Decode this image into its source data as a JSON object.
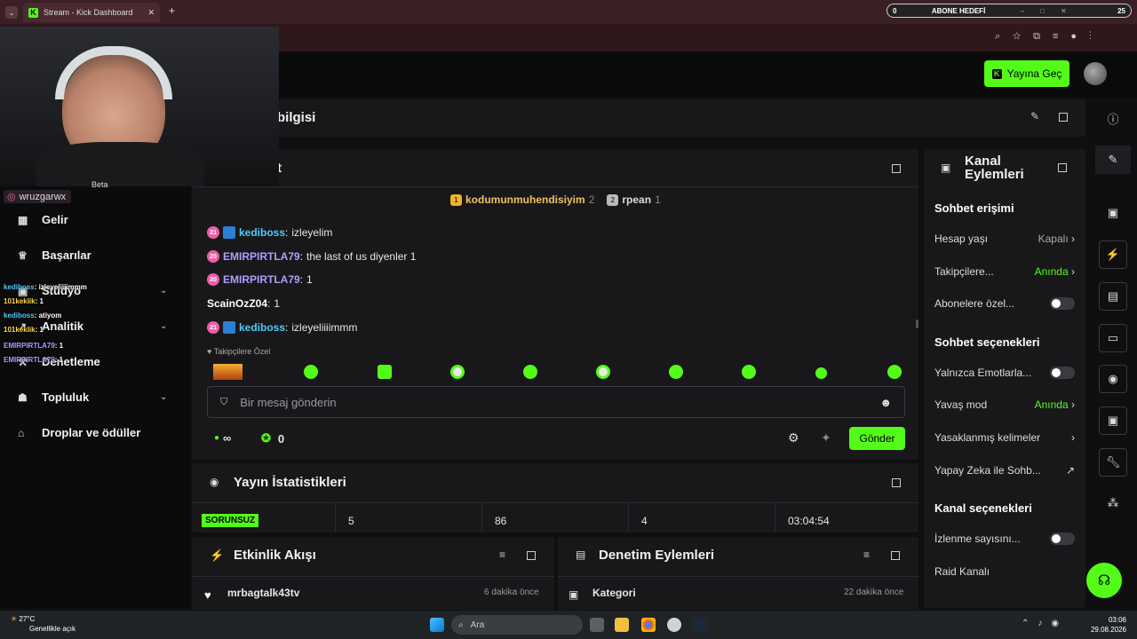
{
  "browser": {
    "tab_title": "Stream - Kick Dashboard",
    "new_tab": "+",
    "close": "✕"
  },
  "subgoal": {
    "left": "0",
    "title": "ABONE HEDEFİ",
    "right": "25"
  },
  "topbar": {
    "go_live": "Yayına Geç"
  },
  "webcam": {
    "streamer_name": "wruzgarwx",
    "beta": "Beta"
  },
  "overlay_chat": [
    {
      "user": "kediboss",
      "text": ": izleyeliiiimmm"
    },
    {
      "user": "101keklik",
      "text": ": 1"
    },
    {
      "user": "kediboss",
      "text": ": atiyom"
    },
    {
      "user": "101keklik",
      "text": ": 1"
    },
    {
      "user": "EMIRPIRTLA79",
      "text": ": 1"
    },
    {
      "user": "EMIRPIRTLA79",
      "text": ": 1"
    }
  ],
  "sidebar": {
    "items": [
      {
        "label": "Gelir",
        "icon": "revenue-icon"
      },
      {
        "label": "Başarılar",
        "icon": "trophy-icon"
      },
      {
        "label": "Stüdyo",
        "icon": "studio-icon"
      },
      {
        "label": "Analitik",
        "icon": "analytics-icon"
      },
      {
        "label": "Denetleme",
        "icon": "moderation-icon"
      },
      {
        "label": "Topluluk",
        "icon": "community-icon"
      },
      {
        "label": "Droplar ve ödüller",
        "icon": "drops-icon"
      }
    ]
  },
  "stream_info": {
    "title": "bilgisi"
  },
  "chat": {
    "title": "t",
    "leaderboard": [
      {
        "rank": "1",
        "name": "kodumunmuhendisiyim",
        "count": "2"
      },
      {
        "rank": "2",
        "name": "rpean",
        "count": "1"
      }
    ],
    "messages": [
      {
        "badge": "21",
        "user": "kediboss",
        "text": "izleyelim",
        "style": "u1",
        "sub": true
      },
      {
        "badge": "20",
        "user": "EMIRPIRTLA79",
        "text": "the last of us diyenler 1",
        "style": "u2",
        "sub": false
      },
      {
        "badge": "20",
        "user": "EMIRPIRTLA79",
        "text": "1",
        "style": "u2",
        "sub": false
      },
      {
        "badge": "",
        "user": "ScainOzZ04",
        "text": "1",
        "style": "u3",
        "sub": false
      },
      {
        "badge": "21",
        "user": "kediboss",
        "text": "izleyeliiiimmm",
        "style": "u1",
        "sub": true
      }
    ],
    "followers_only": "Takipçilere Özel",
    "input_placeholder": "Bir mesaj gönderin",
    "viewers": "∞",
    "kicks": "0",
    "send": "Gönder"
  },
  "stats": {
    "title": "Yayın İstatistikleri",
    "status": "SORUNSUZ",
    "values": [
      "5",
      "86",
      "4",
      "03:04:54"
    ]
  },
  "activity": {
    "title": "Etkinlik Akışı",
    "item_user": "mrbagtalk43tv",
    "item_time": "6 dakika önce"
  },
  "moderation": {
    "title": "Denetim Eylemleri",
    "item_label": "Kategori",
    "item_time": "22 dakika önce"
  },
  "channel_actions": {
    "title_line1": "Kanal",
    "title_line2": "Eylemleri",
    "chat_access": "Sohbet erişimi",
    "account_age": "Hesap yaşı",
    "account_age_val": "Kapalı",
    "followers": "Takipçilere...",
    "followers_val": "Anında",
    "subs_only": "Abonelere özel...",
    "chat_options": "Sohbet seçenekleri",
    "emotes_only": "Yalnızca Emotlarla...",
    "slow_mode": "Yavaş mod",
    "slow_mode_val": "Anında",
    "banned_words": "Yasaklanmış kelimeler",
    "ai_chat": "Yapay Zeka ile Sohb...",
    "channel_options": "Kanal seçenekleri",
    "view_count": "İzlenme sayısını...",
    "raid": "Raid Kanalı"
  },
  "taskbar": {
    "weather_temp": "27°C",
    "weather_desc": "Genellikle açık",
    "search": "Ara",
    "time": "03:06",
    "date": "29.08.2026"
  },
  "colors": {
    "accent": "#53fc18",
    "panel": "#18181b",
    "bg": "#0f0f10"
  }
}
